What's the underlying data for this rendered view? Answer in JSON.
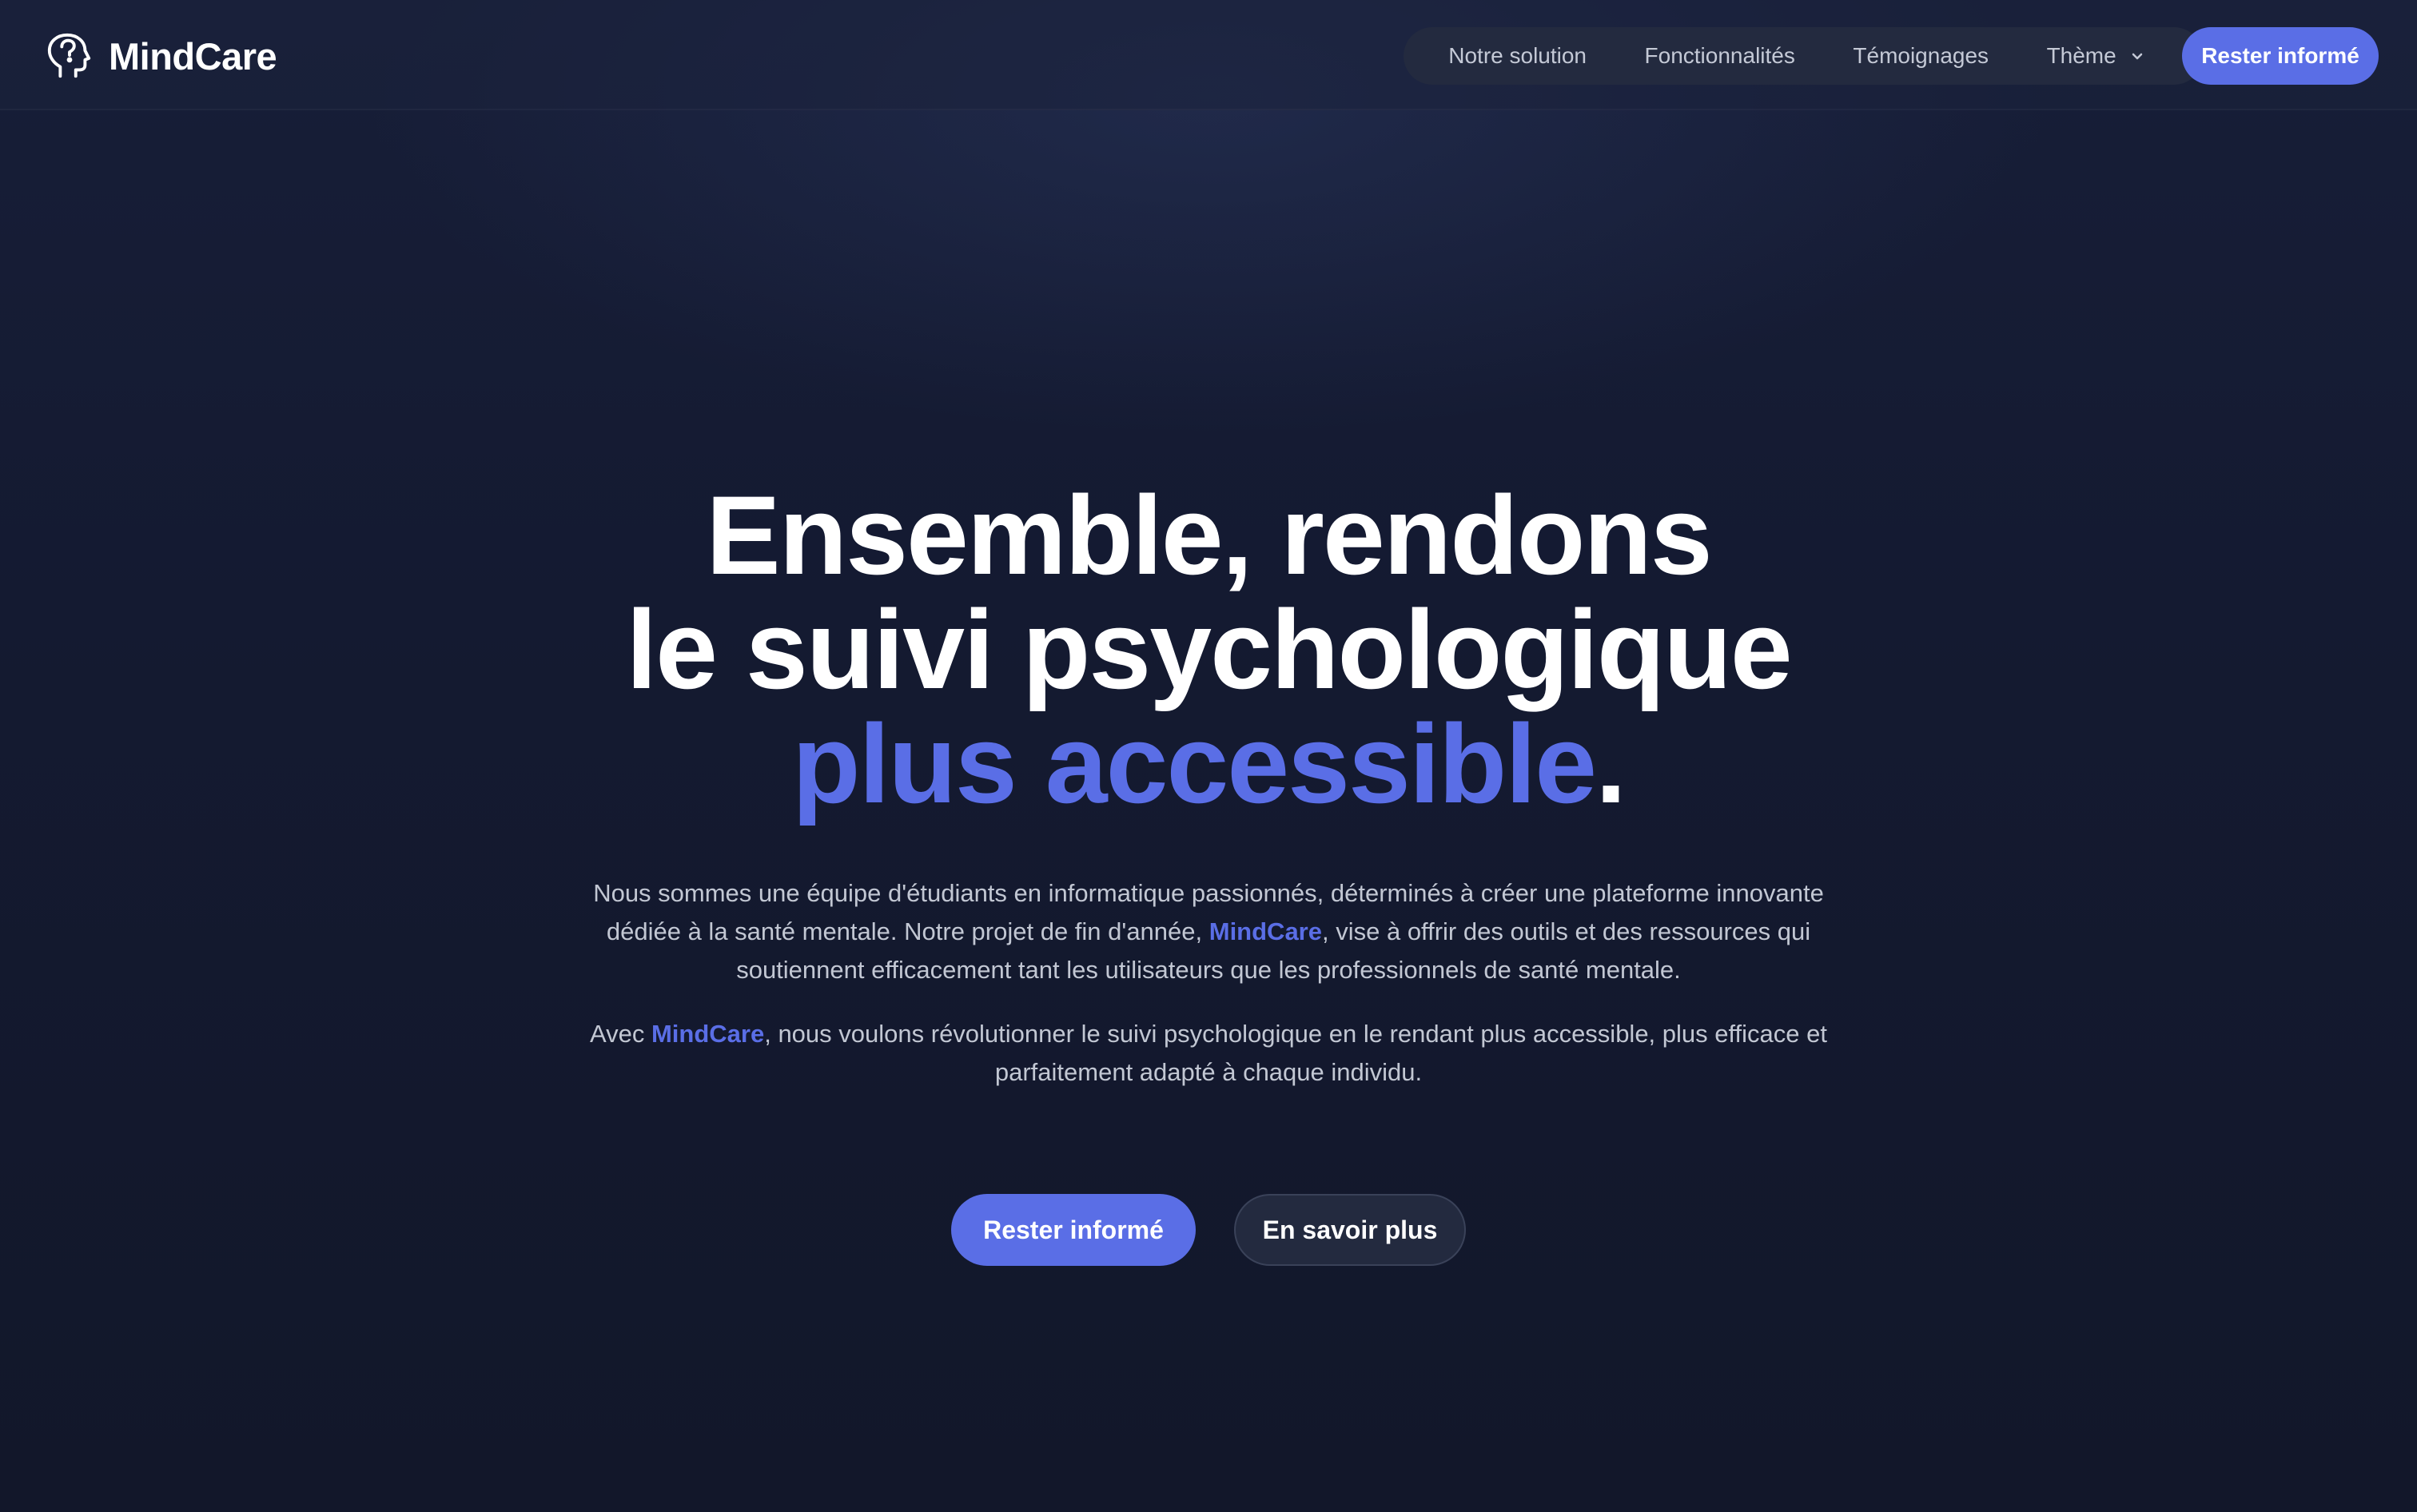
{
  "header": {
    "brand": "MindCare",
    "logo_icon": "head-icon",
    "nav": [
      {
        "label": "Notre solution"
      },
      {
        "label": "Fonctionnalités"
      },
      {
        "label": "Témoignages"
      },
      {
        "label": "Thème",
        "icon": "chevron-down-icon"
      }
    ],
    "cta_label": "Rester informé"
  },
  "hero": {
    "title_line1": "Ensemble, rendons",
    "title_line2": "le suivi psychologique",
    "title_accent": "plus accessible",
    "title_end": ".",
    "desc1_before": "Nous sommes une équipe d'étudiants en informatique passionnés, déterminés à créer une plateforme innovante dédiée à la santé mentale. Notre projet de fin d'année, ",
    "desc1_brand": "MindCare",
    "desc1_after": ", vise à offrir des outils et des ressources qui soutiennent efficacement tant les utilisateurs que les professionnels de santé mentale.",
    "desc2_before": "Avec ",
    "desc2_brand": "MindCare",
    "desc2_after": ", nous voulons révolutionner le suivi psychologique en le rendant plus accessible, plus efficace et parfaitement adapté à chaque individu.",
    "primary_cta": "Rester informé",
    "secondary_cta": "En savoir plus"
  },
  "colors": {
    "accent": "#5a6ee6",
    "background": "#12172a",
    "nav_pill": "#232a3f"
  }
}
